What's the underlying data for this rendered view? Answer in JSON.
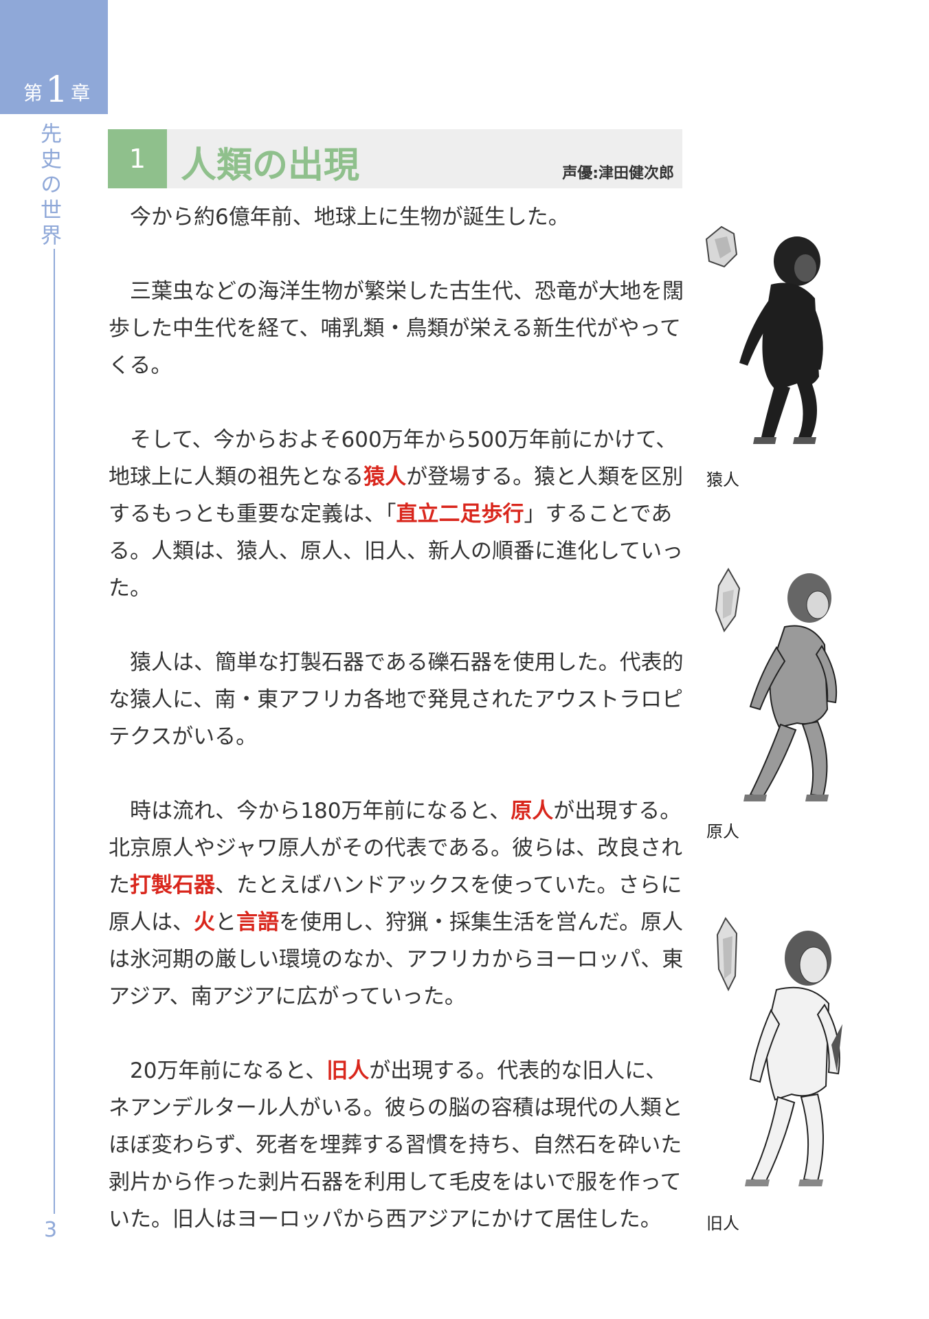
{
  "sidebar": {
    "chapter_prefix": "第",
    "chapter_number": "1",
    "chapter_suffix": "章",
    "section_title": "先史の世界",
    "page_number": "3"
  },
  "heading": {
    "number": "1",
    "title": "人類の出現",
    "voice_credit": "声優:津田健次郎"
  },
  "paragraphs": [
    [
      {
        "t": "今から約6億年前、地球上に生物が誕生した。"
      }
    ],
    [
      {
        "t": "三葉虫などの海洋生物が繁栄した古生代、恐竜が大地を闊歩した中生代を経て、哺乳類・鳥類が栄える新生代がやってくる。"
      }
    ],
    [
      {
        "t": "そして、今からおよそ600万年から500万年前にかけて、地球上に人類の祖先となる"
      },
      {
        "t": "猿人",
        "hl": true
      },
      {
        "t": "が登場する。猿と人類を区別するもっとも重要な定義は、「"
      },
      {
        "t": "直立二足歩行",
        "hl": true
      },
      {
        "t": "」することである。人類は、猿人、原人、旧人、新人の順番に進化していった。"
      }
    ],
    [
      {
        "t": "猿人は、簡単な打製石器である礫石器を使用した。代表的な猿人に、南・東アフリカ各地で発見されたアウストラロピテクスがいる。"
      }
    ],
    [
      {
        "t": "時は流れ、今から180万年前になると、"
      },
      {
        "t": "原人",
        "hl": true
      },
      {
        "t": "が出現する。北京原人やジャワ原人がその代表である。彼らは、改良された"
      },
      {
        "t": "打製石器",
        "hl": true
      },
      {
        "t": "、たとえばハンドアックスを使っていた。さらに原人は、"
      },
      {
        "t": "火",
        "hl": true
      },
      {
        "t": "と"
      },
      {
        "t": "言語",
        "hl": true
      },
      {
        "t": "を使用し、狩猟・採集生活を営んだ。原人は氷河期の厳しい環境のなか、アフリカからヨーロッパ、東アジア、南アジアに広がっていった。"
      }
    ],
    [
      {
        "t": "20万年前になると、"
      },
      {
        "t": "旧人",
        "hl": true
      },
      {
        "t": "が出現する。代表的な旧人に、ネアンデルタール人がいる。彼らの脳の容積は現代の人類とほぼ変わらず、死者を埋葬する習慣を持ち、自然石を砕いた剥片から作った剥片石器を利用して毛皮をはいで服を作っていた。旧人はヨーロッパから西アジアにかけて居住した。"
      }
    ]
  ],
  "figures": [
    {
      "caption": "猿人",
      "icon": "ape-man-illustration"
    },
    {
      "caption": "原人",
      "icon": "homo-erectus-illustration"
    },
    {
      "caption": "旧人",
      "icon": "neanderthal-illustration"
    }
  ],
  "colors": {
    "sidebar_blue": "#8fa8d8",
    "heading_green": "#8fc08c",
    "highlight_red": "#d9261c"
  }
}
